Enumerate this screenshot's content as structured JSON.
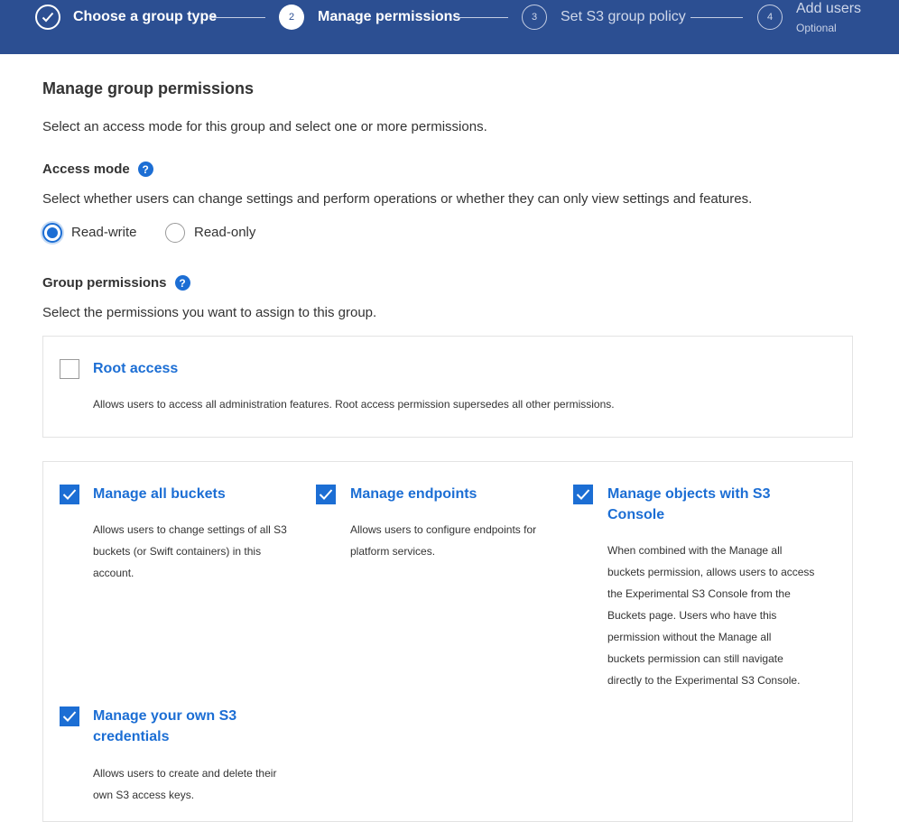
{
  "stepper": {
    "steps": [
      {
        "label": "Choose a group type",
        "status": "done"
      },
      {
        "number": "2",
        "label": "Manage permissions",
        "status": "active"
      },
      {
        "number": "3",
        "label": "Set S3 group policy",
        "status": "inactive"
      },
      {
        "number": "4",
        "label": "Add users",
        "sublabel": "Optional",
        "status": "inactive"
      }
    ],
    "colors": {
      "background": "#2c4f92",
      "accent": "#1c6ed4"
    }
  },
  "main": {
    "title": "Manage group permissions",
    "intro": "Select an access mode for this group and select one or more permissions.",
    "access_mode": {
      "label": "Access mode",
      "help_icon": "question-circle-icon",
      "description": "Select whether users can change settings and perform operations or whether they can only view settings and features.",
      "options": [
        {
          "label": "Read-write",
          "selected": true
        },
        {
          "label": "Read-only",
          "selected": false
        }
      ]
    },
    "group_permissions": {
      "label": "Group permissions",
      "help_icon": "question-circle-icon",
      "description": "Select the permissions you want to assign to this group.",
      "root_access": {
        "title": "Root access",
        "checked": false,
        "description": "Allows users to access all administration features. Root access permission supersedes all other permissions."
      },
      "permissions": [
        {
          "title_lines": [
            "Manage all buckets"
          ],
          "checked": true,
          "description_lines": [
            "Allows users to change settings of all S3",
            "buckets (or Swift containers) in this",
            "account."
          ]
        },
        {
          "title_lines": [
            "Manage endpoints"
          ],
          "checked": true,
          "description_lines": [
            "Allows users to configure endpoints for",
            "platform services."
          ]
        },
        {
          "title_lines": [
            "Manage objects with S3",
            "Console"
          ],
          "checked": true,
          "description_lines": [
            "When combined with the Manage all",
            "buckets permission, allows users to access",
            "the Experimental S3 Console from the",
            "Buckets page. Users who have this",
            "permission without the Manage all",
            "buckets permission can still navigate",
            "directly to the Experimental S3 Console."
          ]
        },
        {
          "title_lines": [
            "Manage your own S3",
            "credentials"
          ],
          "checked": true,
          "description_lines": [
            "Allows users to create and delete their",
            "own S3 access keys."
          ]
        }
      ]
    }
  }
}
